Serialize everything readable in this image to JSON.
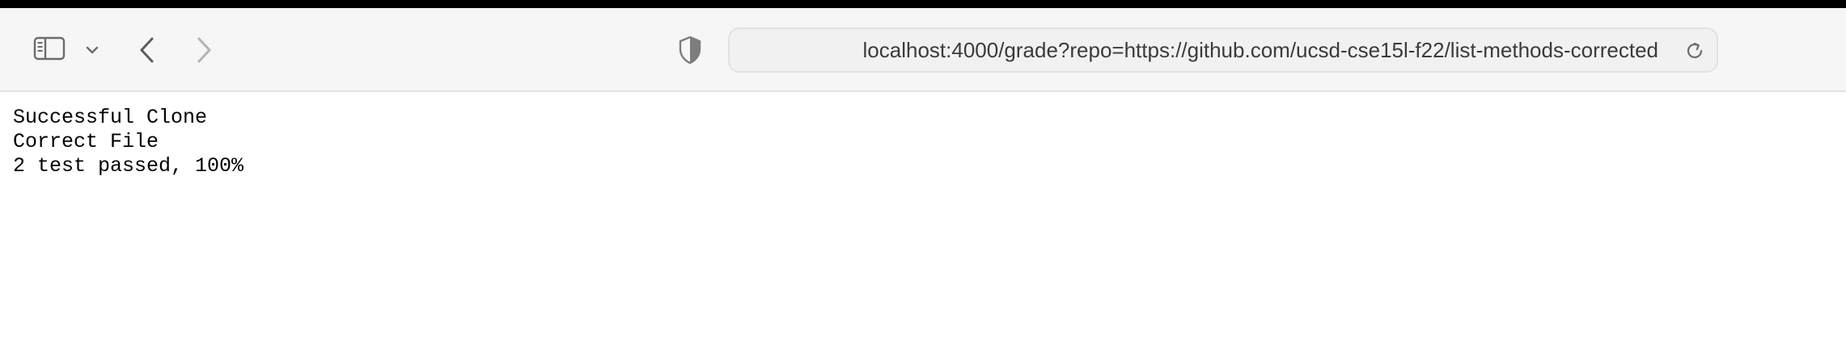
{
  "browser": {
    "address_bar": {
      "url": "localhost:4000/grade?repo=https://github.com/ucsd-cse15l-f22/list-methods-corrected"
    },
    "icons": {
      "sidebar": "sidebar-icon",
      "sidebar_menu": "chevron-down-icon",
      "back": "chevron-left-icon",
      "forward": "chevron-right-icon",
      "privacy": "shield-icon",
      "reload": "reload-icon"
    }
  },
  "page": {
    "lines": [
      "Successful Clone",
      "Correct File",
      "2 test passed, 100%"
    ]
  }
}
